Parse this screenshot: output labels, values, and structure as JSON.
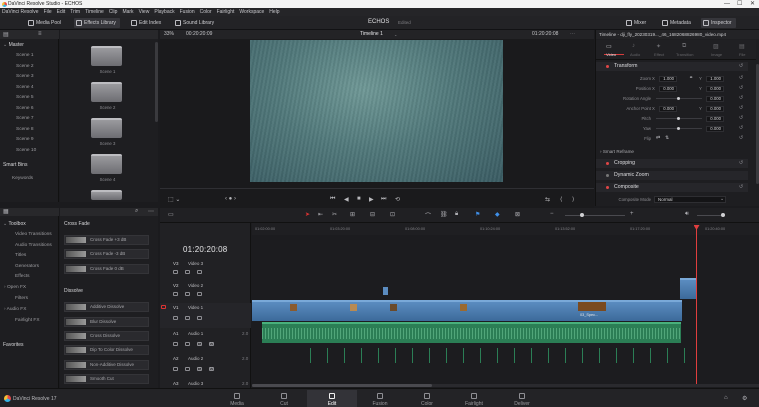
{
  "window": {
    "title": "DaVinci Resolve Studio - ECHOS",
    "controls": [
      "—",
      "☐",
      "✕"
    ]
  },
  "menu": [
    "DaVinci Resolve",
    "File",
    "Edit",
    "Trim",
    "Timeline",
    "Clip",
    "Mark",
    "View",
    "Playback",
    "Fusion",
    "Color",
    "Fairlight",
    "Workspace",
    "Help"
  ],
  "toolbar": {
    "media_pool": "Media Pool",
    "effects_library": "Effects Library",
    "edit_index": "Edit Index",
    "sound_library": "Sound Library",
    "project_name": "ECHOS",
    "project_status": "Edited",
    "mixer": "Mixer",
    "metadata": "Metadata",
    "inspector": "Inspector"
  },
  "bins": {
    "master": "Master",
    "scenes": [
      "Scene 1",
      "Scene 2",
      "Scene 3",
      "Scene 4",
      "Scene 5",
      "Scene 6",
      "Scene 7",
      "Scene 8",
      "Scene 9",
      "Scene 10"
    ],
    "smart_bins": "Smart Bins",
    "keywords": "Keywords"
  },
  "media_pool_clips": [
    "Scene 1",
    "Scene 2",
    "Scene 3",
    "Scene 4"
  ],
  "viewer": {
    "zoom": "33%",
    "source_tc": "00:20:20:09",
    "timeline_name": "Timeline 1",
    "record_tc": "01:20:20:08"
  },
  "inspector": {
    "clip_title": "Timeline - dji_fly_20230319..._46_1682068826980_video.mp4",
    "tabs": [
      "Video",
      "Audio",
      "Effect",
      "Transition",
      "Image",
      "File"
    ],
    "transform": "Transform",
    "zoom_label": "Zoom",
    "zoom_x": "1.000",
    "zoom_y": "1.000",
    "position_label": "Position",
    "pos_x": "0.000",
    "pos_y": "0.000",
    "rotation_label": "Rotation Angle",
    "rotation": "0.000",
    "anchor_label": "Anchor Point",
    "anchor_x": "0.000",
    "anchor_y": "0.000",
    "pitch_label": "Pitch",
    "pitch": "0.000",
    "yaw_label": "Yaw",
    "yaw": "0.000",
    "flip_label": "Flip",
    "smart_reframe": "Smart Reframe",
    "cropping": "Cropping",
    "dynamic_zoom": "Dynamic Zoom",
    "composite": "Composite",
    "composite_mode_label": "Composite Mode",
    "composite_mode": "Normal"
  },
  "toolbox": {
    "toolbox": "Toolbox",
    "items": [
      "Video Transitions",
      "Audio Transitions",
      "Titles",
      "Generators",
      "Effects"
    ],
    "open_fx": "Open FX",
    "filters": "Filters",
    "audio_fx": "Audio FX",
    "fairlight_fx": "Fairlight FX",
    "favorites": "Favorites"
  },
  "effects": {
    "cross_fade": "Cross Fade",
    "cross_fade_items": [
      "Cross Fade +3 dB",
      "Cross Fade -3 dB",
      "Cross Fade 0 dB"
    ],
    "dissolve": "Dissolve",
    "dissolve_items": [
      "Additive Dissolve",
      "Blur Dissolve",
      "Cross Dissolve",
      "Dip To Color Dissolve",
      "Non-Additive Dissolve",
      "Smooth Cut"
    ]
  },
  "timeline": {
    "timecode": "01:20:20:08",
    "ruler": [
      "01:02:00:00",
      "01:03:20:00",
      "01:08:00:00",
      "01:10:24:00",
      "01:13:52:00",
      "01:17:20:00",
      "01:20:40:00"
    ],
    "tracks": [
      {
        "id": "V3",
        "name": "Video 3"
      },
      {
        "id": "V2",
        "name": "Video 2"
      },
      {
        "id": "V1",
        "name": "Video 1"
      },
      {
        "id": "A1",
        "name": "Audio 1",
        "ch": "2.0"
      },
      {
        "id": "A2",
        "name": "Audio 2",
        "ch": "2.0"
      },
      {
        "id": "A3",
        "name": "Audio 3",
        "ch": "2.0"
      }
    ],
    "clip_label": "03_Spec..."
  },
  "pages": [
    "Media",
    "Cut",
    "Edit",
    "Fusion",
    "Color",
    "Fairlight",
    "Deliver"
  ],
  "active_page": "Edit",
  "brand": "DaVinci Resolve 17"
}
